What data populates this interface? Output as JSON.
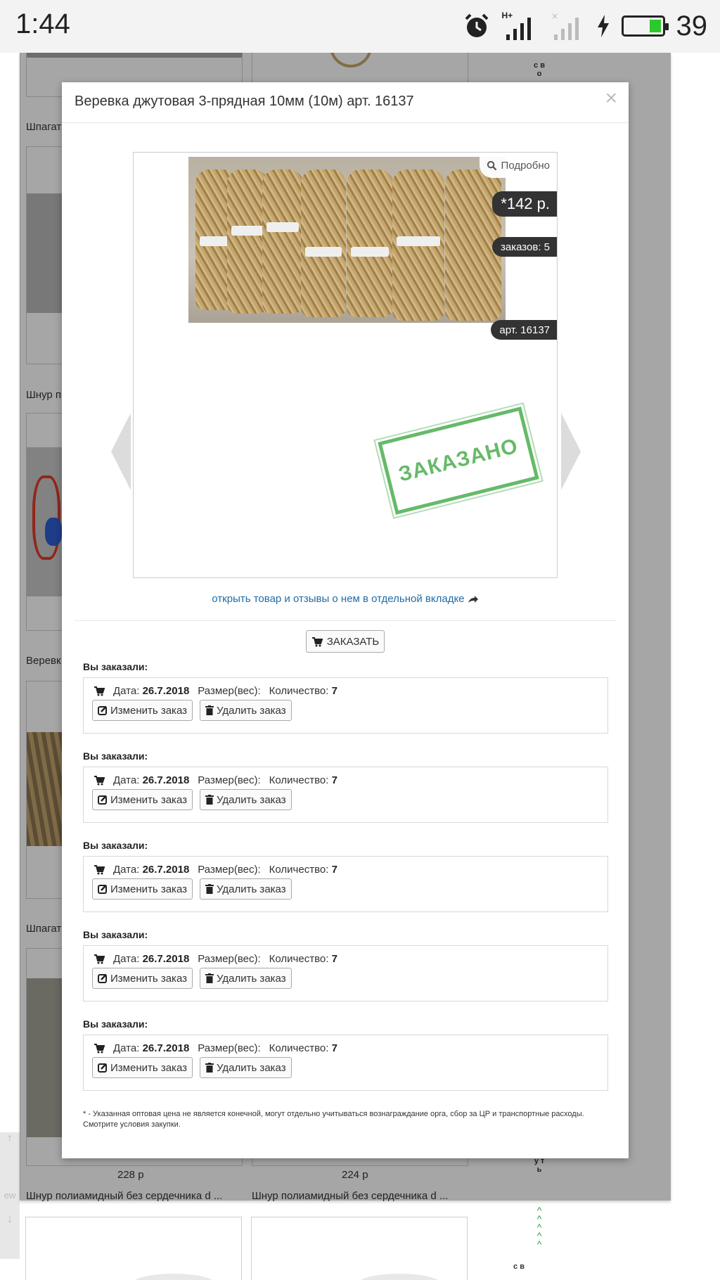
{
  "status_bar": {
    "time": "1:44",
    "network": "H+",
    "battery_percent": "39",
    "battery_level": 0.39,
    "battery_color": "#2bc92b"
  },
  "background_page": {
    "captions": {
      "row1_left": "Шпагат",
      "row2_left": "Шнур п",
      "row3_left": "Веревк",
      "row4_left": "Шпагат"
    },
    "bottom_cards": [
      {
        "price": "228 р",
        "title": "Шнур полиамидный без сердечника d ..."
      },
      {
        "price": "224 р",
        "title": "Шнур полиамидный без сердечника d ..."
      }
    ],
    "vertical_text_top": "с в о",
    "vertical_text_bottom": "у т ь",
    "vertical_text_last": "с в"
  },
  "modal": {
    "title": "Веревка джутовая 3-прядная 10мм (10м) арт. 16137",
    "close_symbol": "×",
    "detail_label": "Подробно",
    "price_tag": "*142 р.",
    "orders_tag": "заказов: 5",
    "art_tag": "арт. 16137",
    "stamp_text": "ЗАКАЗАНО",
    "open_link": "открыть товар и отзывы о нем в отдельной вкладке",
    "order_button": "ЗАКАЗАТЬ",
    "orders": [
      {
        "label": "Вы заказали:",
        "date_label": "Дата:",
        "date": "26.7.2018",
        "size_label": "Размер(вес):",
        "qty_label": "Количество:",
        "qty": "7",
        "edit": "Изменить заказ",
        "delete": "Удалить заказ"
      },
      {
        "label": "Вы заказали:",
        "date_label": "Дата:",
        "date": "26.7.2018",
        "size_label": "Размер(вес):",
        "qty_label": "Количество:",
        "qty": "7",
        "edit": "Изменить заказ",
        "delete": "Удалить заказ"
      },
      {
        "label": "Вы заказали:",
        "date_label": "Дата:",
        "date": "26.7.2018",
        "size_label": "Размер(вес):",
        "qty_label": "Количество:",
        "qty": "7",
        "edit": "Изменить заказ",
        "delete": "Удалить заказ"
      },
      {
        "label": "Вы заказали:",
        "date_label": "Дата:",
        "date": "26.7.2018",
        "size_label": "Размер(вес):",
        "qty_label": "Количество:",
        "qty": "7",
        "edit": "Изменить заказ",
        "delete": "Удалить заказ"
      },
      {
        "label": "Вы заказали:",
        "date_label": "Дата:",
        "date": "26.7.2018",
        "size_label": "Размер(вес):",
        "qty_label": "Количество:",
        "qty": "7",
        "edit": "Изменить заказ",
        "delete": "Удалить заказ"
      }
    ],
    "footnote": "* - Указанная оптовая цена не является конечной, могут отдельно учитываться вознаграждание орга, сбор за ЦР и транспортные расходы. Смотрите условия закупки."
  }
}
